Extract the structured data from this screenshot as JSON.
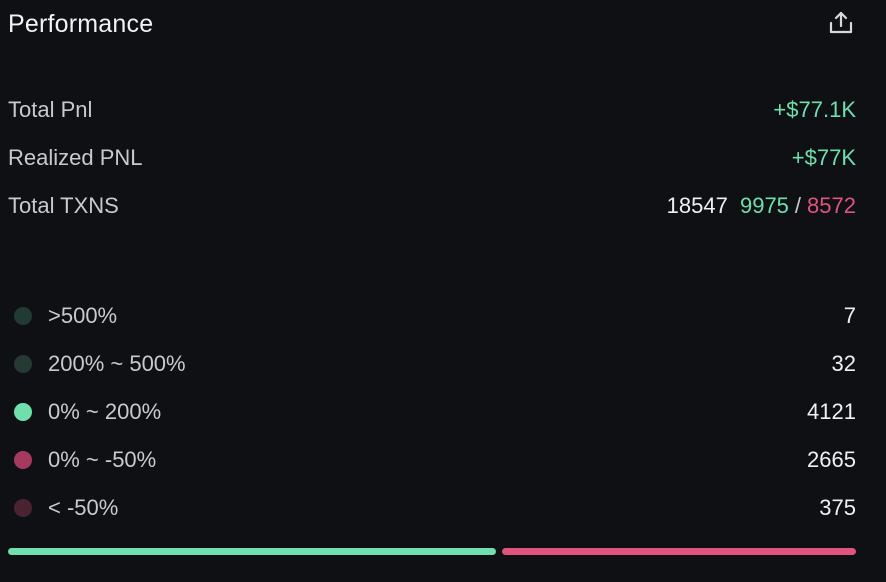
{
  "header": {
    "title": "Performance",
    "share_icon": "share-upload-icon"
  },
  "stats": {
    "total_pnl": {
      "label": "Total Pnl",
      "value": "+$77.1K"
    },
    "realized_pnl": {
      "label": "Realized PNL",
      "value": "+$77K"
    },
    "total_txns": {
      "label": "Total TXNS",
      "total": "18547",
      "buys": "9975",
      "separator": "/",
      "sells": "8572"
    }
  },
  "distribution": [
    {
      "label": ">500%",
      "value": "7",
      "color": "#213a33"
    },
    {
      "label": "200% ~ 500%",
      "value": "32",
      "color": "#253a32"
    },
    {
      "label": "0% ~ 200%",
      "value": "4121",
      "color": "#6fe0ad"
    },
    {
      "label": "0% ~ -50%",
      "value": "2665",
      "color": "#a63a5e"
    },
    {
      "label": "< -50%",
      "value": "375",
      "color": "#4a2331"
    }
  ],
  "bar": {
    "positive_fraction": 0.58,
    "positive_color": "#6fe0ad",
    "negative_color": "#e0537e"
  },
  "colors": {
    "positive": "#6fe0ad",
    "negative": "#e0537e",
    "background": "#0f1013"
  }
}
